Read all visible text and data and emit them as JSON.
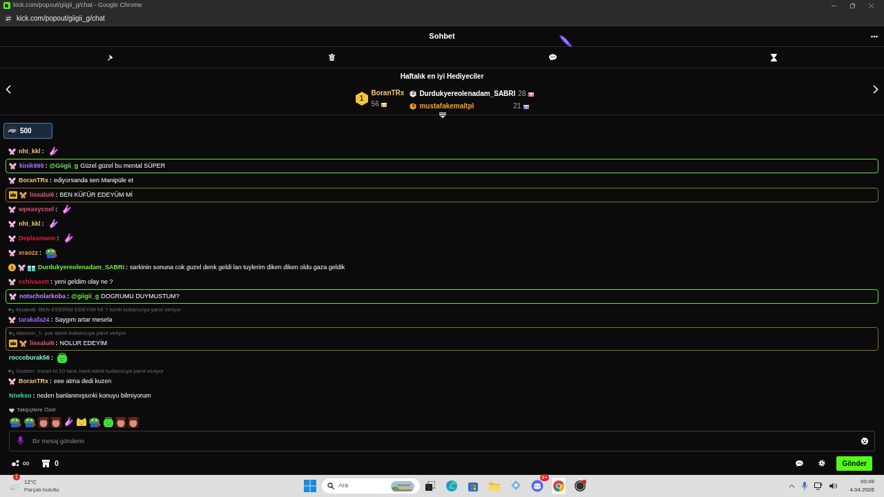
{
  "browser": {
    "title": "kick.com/popout/giigii_g/chat - Google Chrome",
    "url": "kick.com/popout/giigii_g/chat"
  },
  "chat": {
    "title": "Sohbet"
  },
  "gifters": {
    "title": "Haftalık en iyi Hediyeciler",
    "items": [
      {
        "rank": "1",
        "name": "BoranTRx",
        "count": "56",
        "color": "#f5c56b"
      },
      {
        "rank": "2",
        "name": "Durdukyereolenadam_SABRI",
        "count": "28",
        "color": "#ffffff"
      },
      {
        "rank": "3",
        "name": "mustafakemaltpl",
        "count": "21",
        "color": "#f0a030"
      }
    ]
  },
  "pinned": {
    "amount": "500"
  },
  "messages": [
    {
      "badges": [
        {
          "kind": "butterfly"
        }
      ],
      "user": "nht_kkl",
      "color": "#f5c56b",
      "colon": ":",
      "emote": {
        "kind": "hands"
      }
    },
    {
      "badges": [
        {
          "kind": "butterfly"
        }
      ],
      "user": "kinik999",
      "color": "#a970ff",
      "colon": ":",
      "mention": "@Giigii_g",
      "text": "Güzel güzel bu mental SÜPER",
      "highlight": {
        "kind": "mention"
      }
    },
    {
      "badges": [
        {
          "kind": "butterfly"
        }
      ],
      "user": "BoranTRx",
      "color": "#f5c77e",
      "colon": ":",
      "text": "ediyorsanda sen Manipüle et"
    },
    {
      "badges": [
        {
          "kind": "crown"
        },
        {
          "kind": "butterfly-gold"
        }
      ],
      "user": "lissalui6",
      "color": "#e0587a",
      "colon": ":",
      "text": "BEN KÜFÜR EDEYÜM Mİ",
      "highlight": {
        "kind": "vip"
      }
    },
    {
      "badges": [
        {
          "kind": "butterfly"
        }
      ],
      "user": "wpeasycool",
      "color": "#e0507a",
      "colon": ":",
      "emote": {
        "kind": "hands"
      }
    },
    {
      "badges": [
        {
          "kind": "butterfly"
        }
      ],
      "user": "nht_kkl",
      "color": "#f5c56b",
      "colon": ":",
      "emote": {
        "kind": "hands"
      }
    },
    {
      "badges": [
        {
          "kind": "butterfly"
        }
      ],
      "user": "Deplasmann",
      "color": "#e0203a",
      "colon": ":",
      "emote": {
        "kind": "hands"
      }
    },
    {
      "badges": [
        {
          "kind": "butterfly"
        }
      ],
      "user": "xraozz",
      "color": "#f5a030",
      "colon": ":",
      "emote": {
        "kind": "frog"
      }
    },
    {
      "badges": [
        {
          "kind": "rank",
          "label": "1"
        },
        {
          "kind": "butterfly"
        },
        {
          "kind": "gift"
        }
      ],
      "user": "Durdukyereolenadam_SABRI",
      "color": "#72f03c",
      "colon": ":",
      "text": "sarkinin sonuna cok guzel denk geldi lan tuylerim diken diken oldu gaza geldik"
    },
    {
      "badges": [
        {
          "kind": "butterfly"
        }
      ],
      "user": "cchivasstt",
      "color": "#e02040",
      "colon": ":",
      "text": "yeni geldim olay ne ?"
    },
    {
      "badges": [
        {
          "kind": "butterfly"
        }
      ],
      "user": "notscholarkoba",
      "color": "#b88cff",
      "colon": ":",
      "mention": "@giigii_g",
      "text": "DOGRUMU DUYMUSTUM?",
      "highlight": {
        "kind": "mention"
      }
    },
    {
      "reply": "lissalui6: BEN EDERİM EDEYİM Mİ ? isimli kullanıcıya yanıt veriyor",
      "badges": [
        {
          "kind": "butterfly"
        }
      ],
      "user": "tarakafa24",
      "color": "#9b6bff",
      "colon": ":",
      "text": "Saygım artar mesela"
    },
    {
      "reply": "klaxxon_1: yok isimli kullanıcıya yanıt veriyor",
      "badges": [
        {
          "kind": "crown"
        },
        {
          "kind": "butterfly-gold"
        }
      ],
      "user": "lissalui6",
      "color": "#e0587a",
      "colon": ":",
      "text": "NOLUR EDEYİM",
      "highlight": {
        "kind": "vip"
      }
    },
    {
      "user": "roccoburak56",
      "color": "#8af0d0",
      "colon": ":",
      "emote": {
        "kind": "blob"
      }
    },
    {
      "reply": "Gasferr: boran bi 10 tane hanii isimli kullanıcıya yanıt veriyor",
      "badges": [
        {
          "kind": "butterfly"
        }
      ],
      "user": "BoranTRx",
      "color": "#f5c77e",
      "colon": ":",
      "text": "eee atma dedi kuzen"
    },
    {
      "user": "Nnekso",
      "color": "#3cd6a0",
      "colon": ":",
      "text": "neden banlanmışsınki konuyu bilmiyorum"
    }
  ],
  "follower_emotes": {
    "title": "Takipçilere Özel",
    "emotes": [
      {
        "kind": "frog"
      },
      {
        "kind": "frog"
      },
      {
        "kind": "face"
      },
      {
        "kind": "face"
      },
      {
        "kind": "hands"
      },
      {
        "kind": "cat"
      },
      {
        "kind": "frog"
      },
      {
        "kind": "blob"
      },
      {
        "kind": "face"
      },
      {
        "kind": "face"
      }
    ]
  },
  "input": {
    "placeholder": "Bir mesaj gönderin"
  },
  "footer": {
    "points": "∞",
    "store": "0",
    "send": "Gönder"
  },
  "taskbar": {
    "temp": "12°C",
    "weather": "Parçalı bulutlu",
    "weather_badge": "1",
    "search": "Ara",
    "apps": [
      {
        "kind": "edge"
      },
      {
        "kind": "store"
      },
      {
        "kind": "folder"
      },
      {
        "kind": "app"
      },
      {
        "kind": "discord",
        "badge": "9+"
      },
      {
        "kind": "chrome",
        "selected": true
      },
      {
        "kind": "obs"
      }
    ],
    "time": "00:49",
    "date": "4.04.2026"
  }
}
